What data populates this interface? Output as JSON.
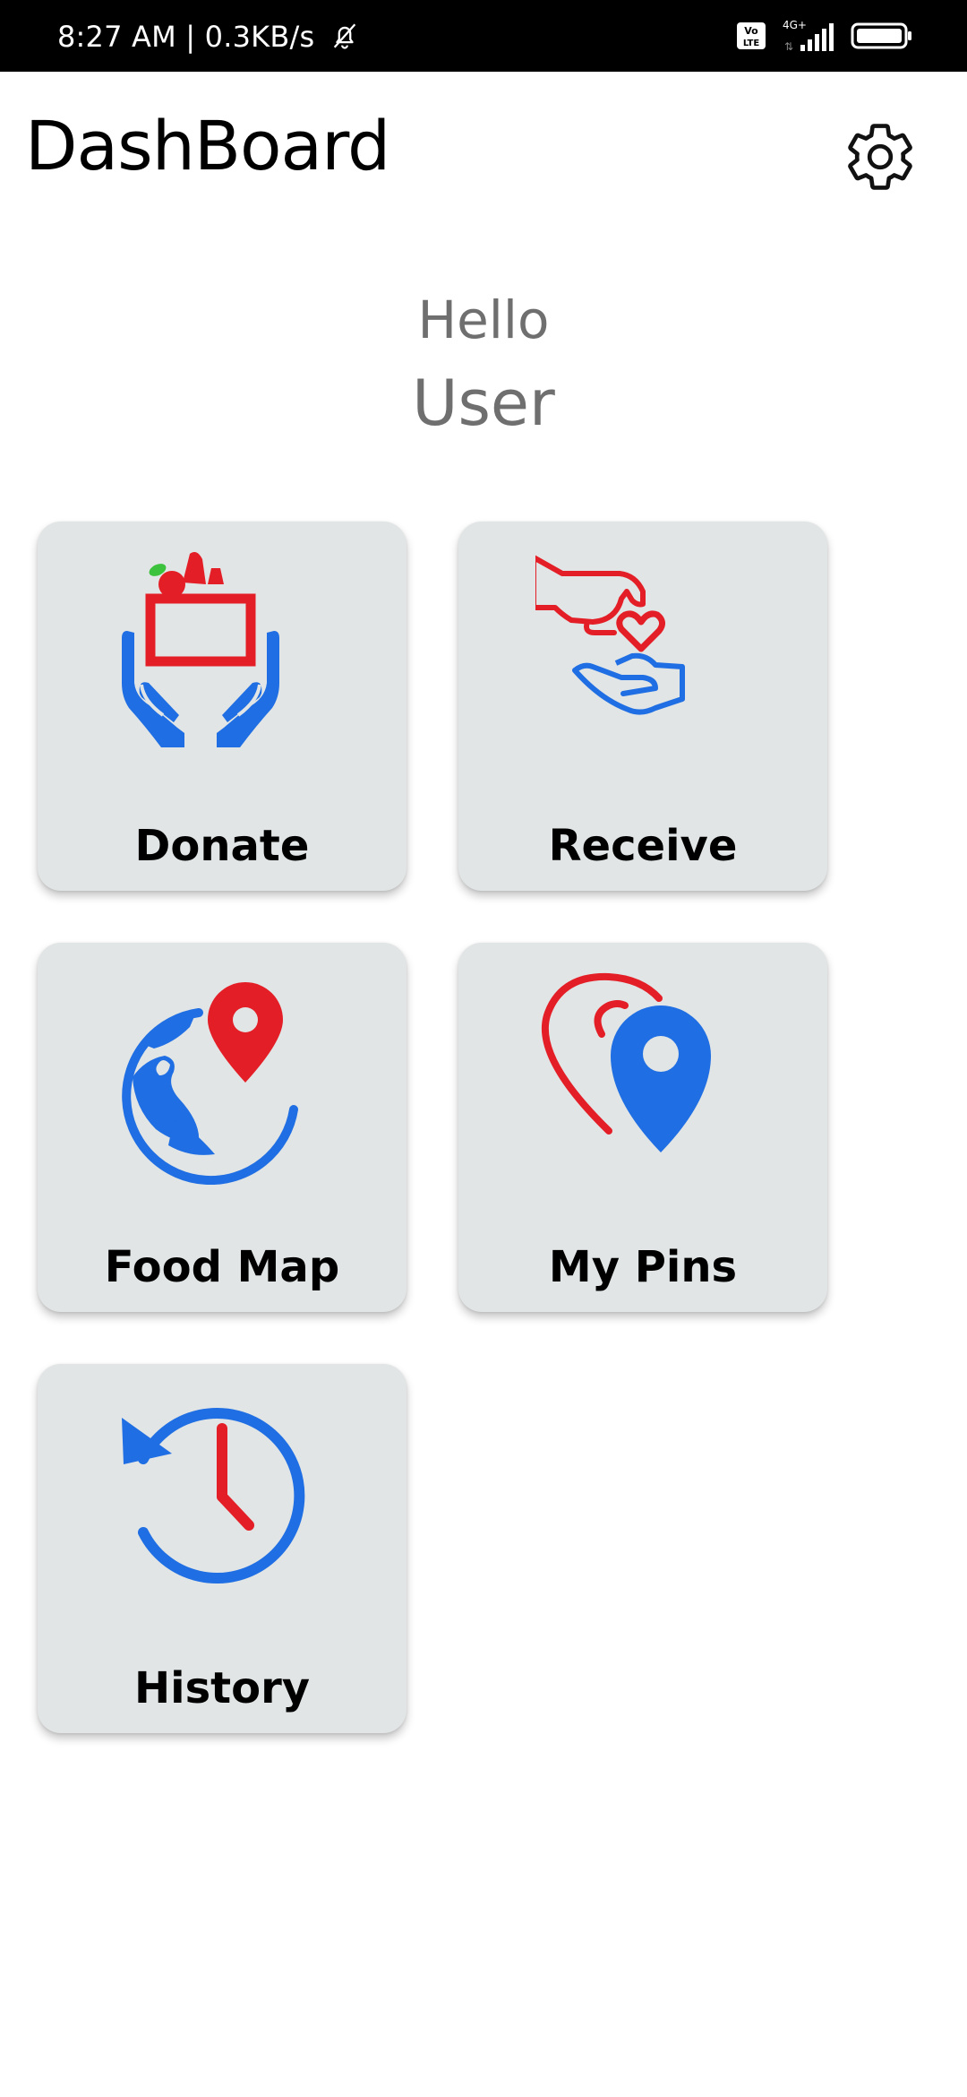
{
  "status_bar": {
    "time_speed": "8:27 AM | 0.3KB/s",
    "volte_label": "Vo LTE",
    "network_label": "4G+"
  },
  "header": {
    "title": "DashBoard"
  },
  "greeting": {
    "hello": "Hello",
    "user": "User"
  },
  "tiles": [
    {
      "label": "Donate",
      "icon": "donate-icon"
    },
    {
      "label": "Receive",
      "icon": "receive-icon"
    },
    {
      "label": "Food Map",
      "icon": "food-map-icon"
    },
    {
      "label": "My Pins",
      "icon": "my-pins-icon"
    },
    {
      "label": "History",
      "icon": "history-icon"
    }
  ],
  "colors": {
    "red": "#e41e26",
    "blue": "#1f6ee3",
    "tile_bg": "#e1e5e5",
    "greeting_text": "#6f6f6f"
  }
}
